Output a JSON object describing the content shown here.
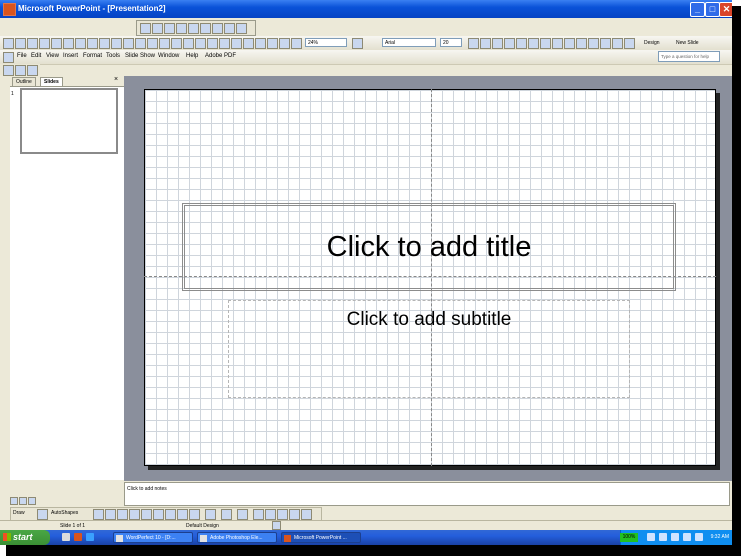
{
  "window": {
    "title": "Microsoft PowerPoint - [Presentation2]",
    "minimize": "_",
    "maximize": "□",
    "close": "✕"
  },
  "menu": {
    "items": [
      "File",
      "Edit",
      "View",
      "Insert",
      "Format",
      "Tools",
      "Slide Show",
      "Window",
      "Help",
      "Adobe PDF"
    ]
  },
  "formatting": {
    "zoom": "24%",
    "font_name": "Arial",
    "font_size": "20",
    "design_label": "Design",
    "new_slide_label": "New Slide"
  },
  "help_box": {
    "placeholder": "Type a question for help"
  },
  "panel": {
    "tab_outline": "Outline",
    "tab_slides": "Slides",
    "close_glyph": "×",
    "slide_number": "1"
  },
  "slide": {
    "title_placeholder": "Click to add title",
    "subtitle_placeholder": "Click to add subtitle"
  },
  "notes": {
    "placeholder": "Click to add notes"
  },
  "drawing": {
    "draw_label": "Draw",
    "autoshapes_label": "AutoShapes"
  },
  "status": {
    "slide_info": "Slide 1 of 1",
    "design": "Default Design"
  },
  "taskbar": {
    "start_label": "start",
    "tasks": [
      "WordPerfect 10 - [D:...",
      "Adobe Photoshop Ele...",
      "Microsoft PowerPoint ..."
    ],
    "tray_badge": "100%",
    "clock": "9:32 AM"
  }
}
